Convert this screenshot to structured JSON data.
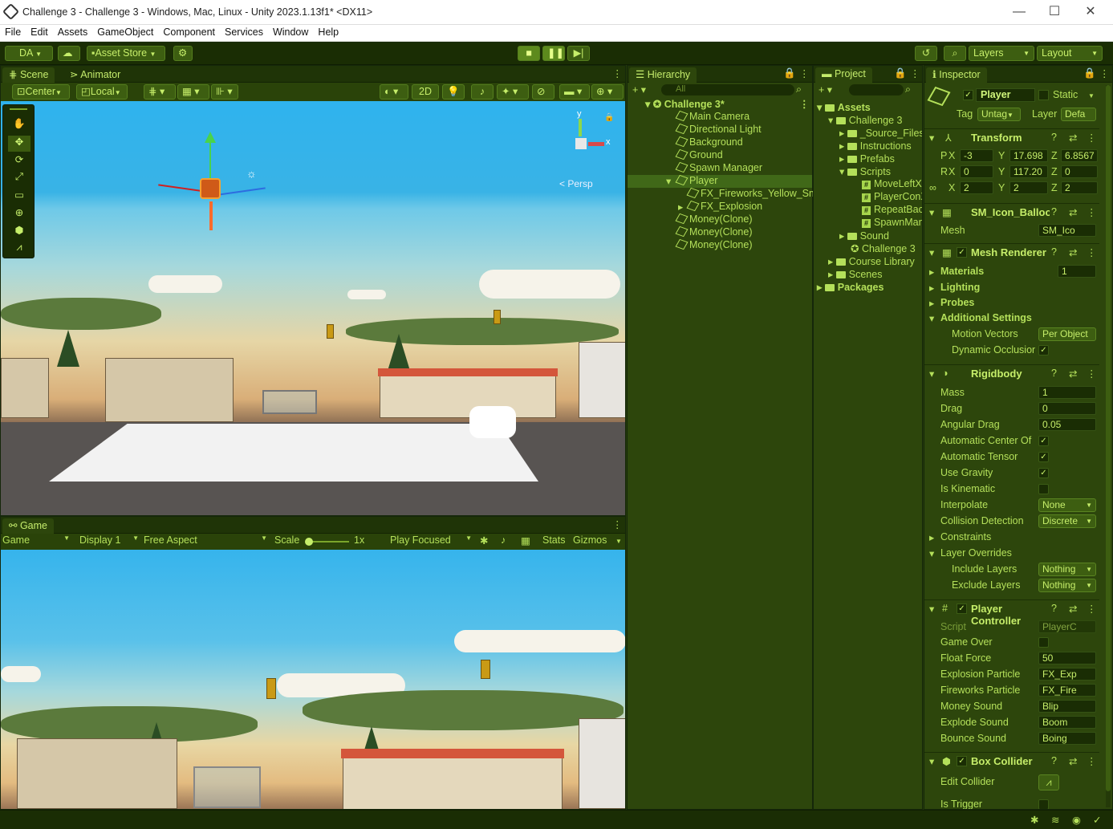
{
  "window": {
    "title": "Challenge 3 - Challenge 3 - Windows, Mac, Linux - Unity 2023.1.13f1* <DX11>",
    "min_glyph": "—",
    "max_glyph": "☐",
    "close_glyph": "✕"
  },
  "menu": [
    "File",
    "Edit",
    "Assets",
    "GameObject",
    "Component",
    "Services",
    "Window",
    "Help"
  ],
  "toolbar": {
    "account": "DA",
    "asset_store": "Asset Store",
    "layers": "Layers",
    "layout": "Layout"
  },
  "scene": {
    "tabs": [
      "Scene",
      "Animator"
    ],
    "pivot": "Center",
    "space": "Local",
    "mode_2d": "2D",
    "persp": "< Persp",
    "gizmo_y": "y",
    "gizmo_x": "x"
  },
  "game": {
    "tab": "Game",
    "view": "Game",
    "display": "Display 1",
    "aspect": "Free Aspect",
    "scale_label": "Scale",
    "scale_value": "1x",
    "play_mode": "Play Focused",
    "stats": "Stats",
    "gizmos": "Gizmos"
  },
  "hierarchy": {
    "tab": "Hierarchy",
    "search_placeholder": "All",
    "root": "Challenge 3*",
    "items": [
      "Main Camera",
      "Directional Light",
      "Background",
      "Ground",
      "Spawn Manager",
      "Player",
      "FX_Fireworks_Yellow_Sm",
      "FX_Explosion",
      "Money(Clone)",
      "Money(Clone)",
      "Money(Clone)"
    ]
  },
  "project": {
    "tab": "Project",
    "items": [
      "Assets",
      "Challenge 3",
      "_Source_Files",
      "Instructions",
      "Prefabs",
      "Scripts",
      "MoveLeftX",
      "PlayerConX",
      "RepeatBackground",
      "SpawnManager",
      "Sound",
      "Challenge 3",
      "Course Library",
      "Scenes",
      "Packages"
    ]
  },
  "inspector": {
    "tab": "Inspector",
    "object_name": "Player",
    "static_label": "Static",
    "tag_label": "Tag",
    "tag_value": "Untag",
    "layer_label": "Layer",
    "layer_value": "Defa",
    "transform": {
      "title": "Transform",
      "pos": {
        "label": "P",
        "x": "-3",
        "y": "17.698",
        "z": "6.8567"
      },
      "rot": {
        "label": "R",
        "x": "0",
        "y": "117.20",
        "z": "0"
      },
      "scale": {
        "x": "2",
        "y": "2",
        "z": "2"
      }
    },
    "mesh_filter": {
      "title": "SM_Icon_Balloon",
      "mesh_label": "Mesh",
      "mesh_value": "SM_Ico"
    },
    "mesh_renderer": {
      "title": "Mesh Renderer",
      "materials_label": "Materials",
      "materials_value": "1",
      "lighting": "Lighting",
      "probes": "Probes",
      "additional": "Additional Settings",
      "motion_label": "Motion Vectors",
      "motion_value": "Per Object",
      "occlusion_label": "Dynamic Occlusion"
    },
    "rigidbody": {
      "title": "Rigidbody",
      "mass_label": "Mass",
      "mass": "1",
      "drag_label": "Drag",
      "drag": "0",
      "adrag_label": "Angular Drag",
      "adrag": "0.05",
      "acom_label": "Automatic Center Of",
      "atensor_label": "Automatic Tensor",
      "gravity_label": "Use Gravity",
      "kinematic_label": "Is Kinematic",
      "interp_label": "Interpolate",
      "interp": "None",
      "coll_label": "Collision Detection",
      "coll": "Discrete",
      "constraints": "Constraints",
      "overrides": "Layer Overrides",
      "include_label": "Include Layers",
      "include": "Nothing",
      "exclude_label": "Exclude Layers",
      "exclude": "Nothing"
    },
    "player_controller": {
      "title": "Player Controller",
      "script_label": "Script",
      "script": "PlayerC",
      "gameover_label": "Game Over",
      "float_label": "Float Force",
      "float": "50",
      "expl_label": "Explosion Particle",
      "expl": "FX_Exp",
      "fire_label": "Fireworks Particle",
      "fire": "FX_Fire",
      "money_label": "Money Sound",
      "money": "Blip",
      "explode_label": "Explode Sound",
      "explode": "Boom",
      "bounce_label": "Bounce Sound",
      "bounce": "Boing"
    },
    "box_collider": {
      "title": "Box Collider",
      "edit_label": "Edit Collider",
      "trigger_label": "Is Trigger"
    }
  }
}
